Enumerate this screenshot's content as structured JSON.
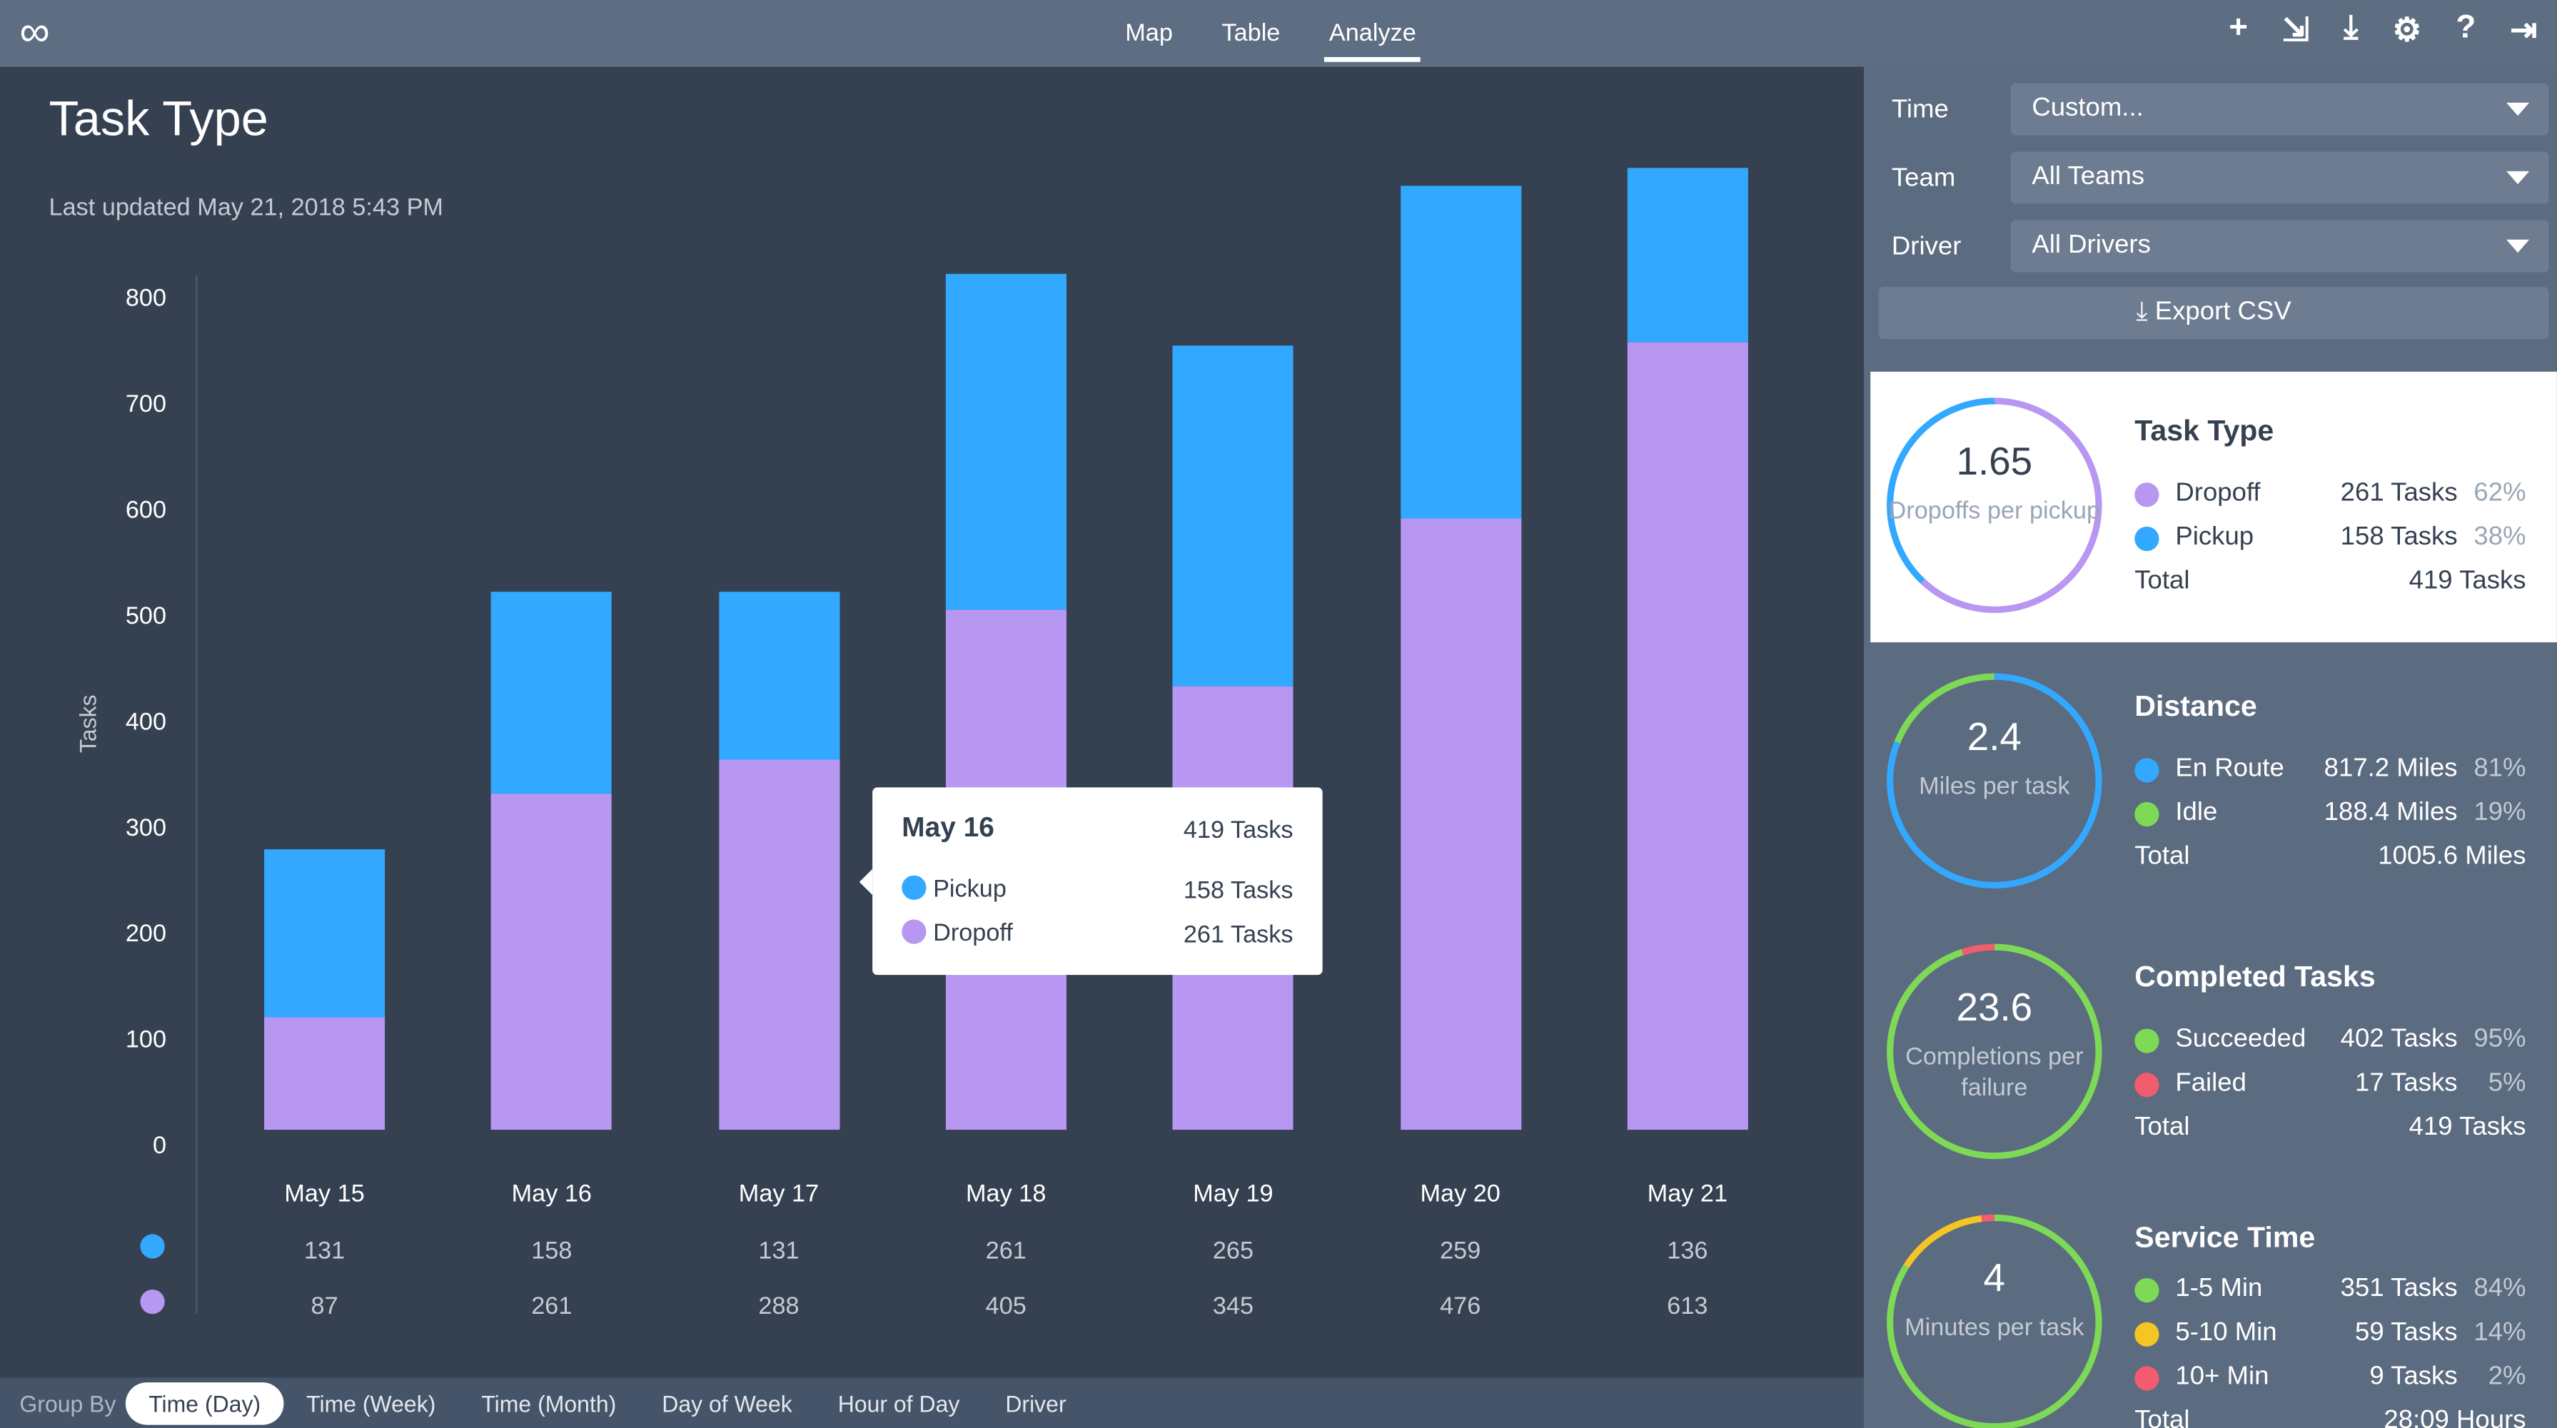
{
  "topbar": {
    "logo": "∞",
    "nav": [
      "Map",
      "Table",
      "Analyze"
    ],
    "active": "Analyze",
    "icons": [
      "plus-icon",
      "import-icon",
      "download-icon",
      "gear-icon",
      "help-icon",
      "logout-icon"
    ]
  },
  "main": {
    "title": "Task Type",
    "updated": "Last updated May 21, 2018 5:43 PM"
  },
  "colors": {
    "pickup": "#33a8ff",
    "dropoff": "#b897f2",
    "green": "#7ed957",
    "red": "#f25c6e",
    "yellow": "#f5c623"
  },
  "chart_data": {
    "type": "bar",
    "stacked": true,
    "ylabel": "Tasks",
    "yticks": [
      0,
      100,
      200,
      300,
      400,
      500,
      600,
      700,
      800
    ],
    "categories": [
      "May 15",
      "May 16",
      "May 17",
      "May 18",
      "May 19",
      "May 20",
      "May 21"
    ],
    "series": [
      {
        "name": "Pickup",
        "color": "#33a8ff",
        "values": [
          131,
          158,
          131,
          261,
          265,
          259,
          136
        ]
      },
      {
        "name": "Dropoff",
        "color": "#b897f2",
        "values": [
          87,
          261,
          288,
          405,
          345,
          476,
          613
        ]
      }
    ]
  },
  "tooltip": {
    "date": "May 16",
    "total": "419 Tasks",
    "rows": [
      {
        "label": "Pickup",
        "value": "158 Tasks"
      },
      {
        "label": "Dropoff",
        "value": "261 Tasks"
      }
    ]
  },
  "groupby": {
    "label": "Group By",
    "options": [
      "Time (Day)",
      "Time (Week)",
      "Time (Month)",
      "Day of Week",
      "Hour of Day",
      "Driver"
    ],
    "selected": "Time (Day)"
  },
  "filters": {
    "time_label": "Time",
    "time_value": "Custom...",
    "team_label": "Team",
    "team_value": "All Teams",
    "driver_label": "Driver",
    "driver_value": "All Drivers",
    "export": "Export CSV"
  },
  "cards": [
    {
      "title": "Task Type",
      "value": "1.65",
      "sub": "Dropoffs per pickup",
      "rows": [
        {
          "label": "Dropoff",
          "value": "261 Tasks",
          "pct": "62%",
          "color": "#b897f2",
          "frac": 0.62
        },
        {
          "label": "Pickup",
          "value": "158 Tasks",
          "pct": "38%",
          "color": "#33a8ff",
          "frac": 0.38
        }
      ],
      "total_label": "Total",
      "total": "419 Tasks"
    },
    {
      "title": "Distance",
      "value": "2.4",
      "sub": "Miles per task",
      "rows": [
        {
          "label": "En Route",
          "value": "817.2 Miles",
          "pct": "81%",
          "color": "#33a8ff",
          "frac": 0.81
        },
        {
          "label": "Idle",
          "value": "188.4 Miles",
          "pct": "19%",
          "color": "#7ed957",
          "frac": 0.19
        }
      ],
      "total_label": "Total",
      "total": "1005.6 Miles"
    },
    {
      "title": "Completed Tasks",
      "value": "23.6",
      "sub": "Completions per failure",
      "rows": [
        {
          "label": "Succeeded",
          "value": "402 Tasks",
          "pct": "95%",
          "color": "#7ed957",
          "frac": 0.95
        },
        {
          "label": "Failed",
          "value": "17 Tasks",
          "pct": "5%",
          "color": "#f25c6e",
          "frac": 0.05
        }
      ],
      "total_label": "Total",
      "total": "419 Tasks"
    },
    {
      "title": "Service Time",
      "value": "4",
      "sub": "Minutes per task",
      "rows": [
        {
          "label": "1-5 Min",
          "value": "351 Tasks",
          "pct": "84%",
          "color": "#7ed957",
          "frac": 0.84
        },
        {
          "label": "5-10 Min",
          "value": "59 Tasks",
          "pct": "14%",
          "color": "#f5c623",
          "frac": 0.14
        },
        {
          "label": "10+ Min",
          "value": "9 Tasks",
          "pct": "2%",
          "color": "#f25c6e",
          "frac": 0.02
        }
      ],
      "total_label": "Total",
      "total": "28:09 Hours"
    }
  ]
}
